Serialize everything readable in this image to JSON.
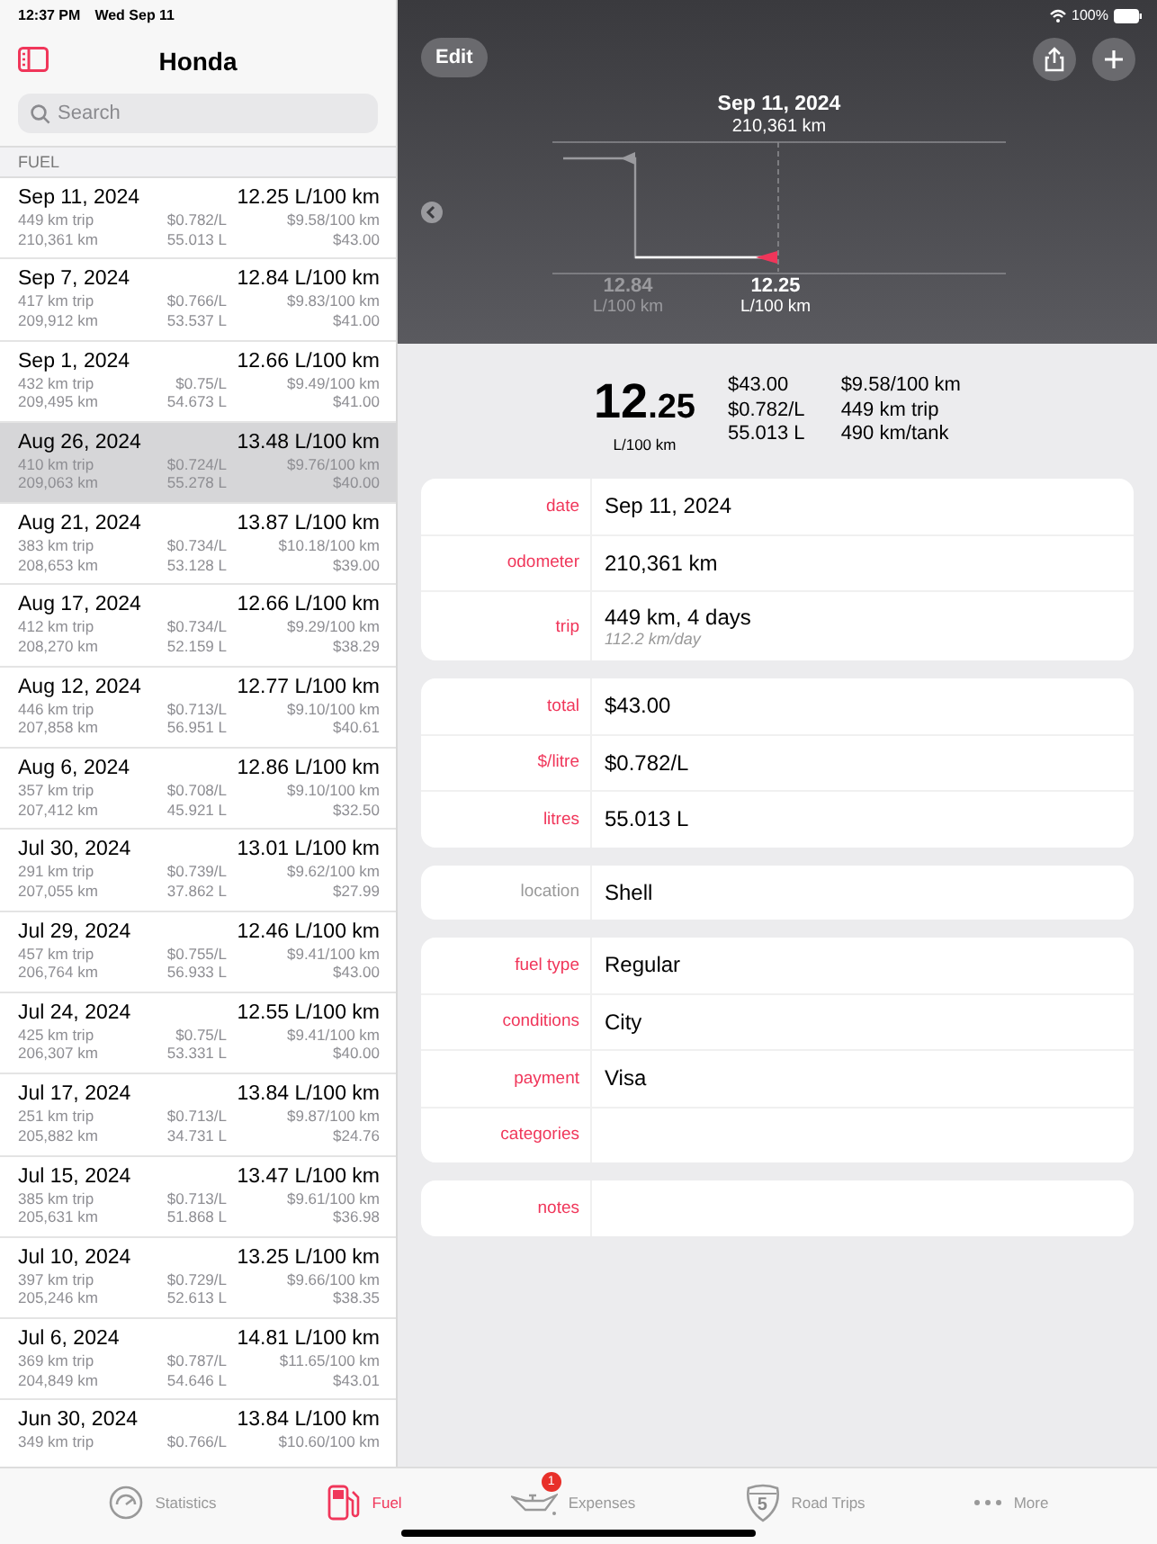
{
  "status_bar": {
    "time": "12:37 PM",
    "date": "Wed Sep 11",
    "battery": "100%"
  },
  "sidebar": {
    "title": "Honda",
    "search": {
      "placeholder": "Search"
    },
    "section": "FUEL",
    "rows": [
      {
        "date": "Sep 11, 2024",
        "consumption": "12.25 L/100 km",
        "trip": "449 km trip",
        "price": "$0.782/L",
        "cost_per_distance": "$9.58/100 km",
        "odometer": "210,361 km",
        "volume": "55.013 L",
        "total": "$43.00",
        "selected": false
      },
      {
        "date": "Sep 7, 2024",
        "consumption": "12.84 L/100 km",
        "trip": "417 km trip",
        "price": "$0.766/L",
        "cost_per_distance": "$9.83/100 km",
        "odometer": "209,912 km",
        "volume": "53.537 L",
        "total": "$41.00",
        "selected": false
      },
      {
        "date": "Sep 1, 2024",
        "consumption": "12.66 L/100 km",
        "trip": "432 km trip",
        "price": "$0.75/L",
        "cost_per_distance": "$9.49/100 km",
        "odometer": "209,495 km",
        "volume": "54.673 L",
        "total": "$41.00",
        "selected": false
      },
      {
        "date": "Aug 26, 2024",
        "consumption": "13.48 L/100 km",
        "trip": "410 km trip",
        "price": "$0.724/L",
        "cost_per_distance": "$9.76/100 km",
        "odometer": "209,063 km",
        "volume": "55.278 L",
        "total": "$40.00",
        "selected": true
      },
      {
        "date": "Aug 21, 2024",
        "consumption": "13.87 L/100 km",
        "trip": "383 km trip",
        "price": "$0.734/L",
        "cost_per_distance": "$10.18/100 km",
        "odometer": "208,653 km",
        "volume": "53.128 L",
        "total": "$39.00",
        "selected": false
      },
      {
        "date": "Aug 17, 2024",
        "consumption": "12.66 L/100 km",
        "trip": "412 km trip",
        "price": "$0.734/L",
        "cost_per_distance": "$9.29/100 km",
        "odometer": "208,270 km",
        "volume": "52.159 L",
        "total": "$38.29",
        "selected": false
      },
      {
        "date": "Aug 12, 2024",
        "consumption": "12.77 L/100 km",
        "trip": "446 km trip",
        "price": "$0.713/L",
        "cost_per_distance": "$9.10/100 km",
        "odometer": "207,858 km",
        "volume": "56.951 L",
        "total": "$40.61",
        "selected": false
      },
      {
        "date": "Aug 6, 2024",
        "consumption": "12.86 L/100 km",
        "trip": "357 km trip",
        "price": "$0.708/L",
        "cost_per_distance": "$9.10/100 km",
        "odometer": "207,412 km",
        "volume": "45.921 L",
        "total": "$32.50",
        "selected": false
      },
      {
        "date": "Jul 30, 2024",
        "consumption": "13.01 L/100 km",
        "trip": "291 km trip",
        "price": "$0.739/L",
        "cost_per_distance": "$9.62/100 km",
        "odometer": "207,055 km",
        "volume": "37.862 L",
        "total": "$27.99",
        "selected": false
      },
      {
        "date": "Jul 29, 2024",
        "consumption": "12.46 L/100 km",
        "trip": "457 km trip",
        "price": "$0.755/L",
        "cost_per_distance": "$9.41/100 km",
        "odometer": "206,764 km",
        "volume": "56.933 L",
        "total": "$43.00",
        "selected": false
      },
      {
        "date": "Jul 24, 2024",
        "consumption": "12.55 L/100 km",
        "trip": "425 km trip",
        "price": "$0.75/L",
        "cost_per_distance": "$9.41/100 km",
        "odometer": "206,307 km",
        "volume": "53.331 L",
        "total": "$40.00",
        "selected": false
      },
      {
        "date": "Jul 17, 2024",
        "consumption": "13.84 L/100 km",
        "trip": "251 km trip",
        "price": "$0.713/L",
        "cost_per_distance": "$9.87/100 km",
        "odometer": "205,882 km",
        "volume": "34.731 L",
        "total": "$24.76",
        "selected": false
      },
      {
        "date": "Jul 15, 2024",
        "consumption": "13.47 L/100 km",
        "trip": "385 km trip",
        "price": "$0.713/L",
        "cost_per_distance": "$9.61/100 km",
        "odometer": "205,631 km",
        "volume": "51.868 L",
        "total": "$36.98",
        "selected": false
      },
      {
        "date": "Jul 10, 2024",
        "consumption": "13.25 L/100 km",
        "trip": "397 km trip",
        "price": "$0.729/L",
        "cost_per_distance": "$9.66/100 km",
        "odometer": "205,246 km",
        "volume": "52.613 L",
        "total": "$38.35",
        "selected": false
      },
      {
        "date": "Jul 6, 2024",
        "consumption": "14.81 L/100 km",
        "trip": "369 km trip",
        "price": "$0.787/L",
        "cost_per_distance": "$11.65/100 km",
        "odometer": "204,849 km",
        "volume": "54.646 L",
        "total": "$43.01",
        "selected": false
      },
      {
        "date": "Jun 30, 2024",
        "consumption": "13.84 L/100 km",
        "trip": "349 km trip",
        "price": "$0.766/L",
        "cost_per_distance": "$10.60/100 km",
        "selected": false
      }
    ]
  },
  "toolbar": {
    "edit": "Edit"
  },
  "chart": {
    "date": "Sep 11, 2024",
    "odometer": "210,361 km",
    "points": [
      {
        "value": "12.84",
        "unit": "L/100 km",
        "selected": false
      },
      {
        "value": "12.25",
        "unit": "L/100 km",
        "selected": true
      }
    ]
  },
  "summary": {
    "value_whole": "12",
    "value_fraction": ".25",
    "unit": "L/100 km",
    "column_1": [
      "$43.00",
      "$0.782/L",
      "55.013 L"
    ],
    "column_2": [
      "$9.58/100 km",
      "449 km trip",
      "490 km/tank"
    ]
  },
  "groups": [
    [
      {
        "label": "date",
        "value": "Sep 11, 2024",
        "accent": true
      },
      {
        "label": "odometer",
        "value": "210,361 km",
        "accent": true
      },
      {
        "label": "trip",
        "value": "449 km, 4 days",
        "note": "112.2 km/day",
        "accent": true
      }
    ],
    [
      {
        "label": "total",
        "value": "$43.00",
        "accent": true
      },
      {
        "label": "$/litre",
        "value": "$0.782/L",
        "accent": true
      },
      {
        "label": "litres",
        "value": "55.013 L",
        "accent": true
      }
    ],
    [
      {
        "label": "location",
        "value": "Shell",
        "accent": false
      }
    ],
    [
      {
        "label": "fuel type",
        "value": "Regular",
        "accent": true
      },
      {
        "label": "conditions",
        "value": "City",
        "accent": true
      },
      {
        "label": "payment",
        "value": "Visa",
        "accent": true
      },
      {
        "label": "categories",
        "accent": true
      }
    ],
    [
      {
        "label": "notes",
        "accent": true
      }
    ]
  ],
  "tab_bar": [
    {
      "kind": "gauge",
      "label": "Statistics",
      "selected": false
    },
    {
      "kind": "pump",
      "label": "Fuel",
      "selected": true
    },
    {
      "kind": "oilcan",
      "label": "Expenses",
      "badge": "1",
      "selected": false
    },
    {
      "kind": "shield",
      "label": "Road Trips",
      "shield_number": "5",
      "selected": false
    },
    {
      "kind": "dots",
      "label": "More",
      "selected": false
    }
  ]
}
